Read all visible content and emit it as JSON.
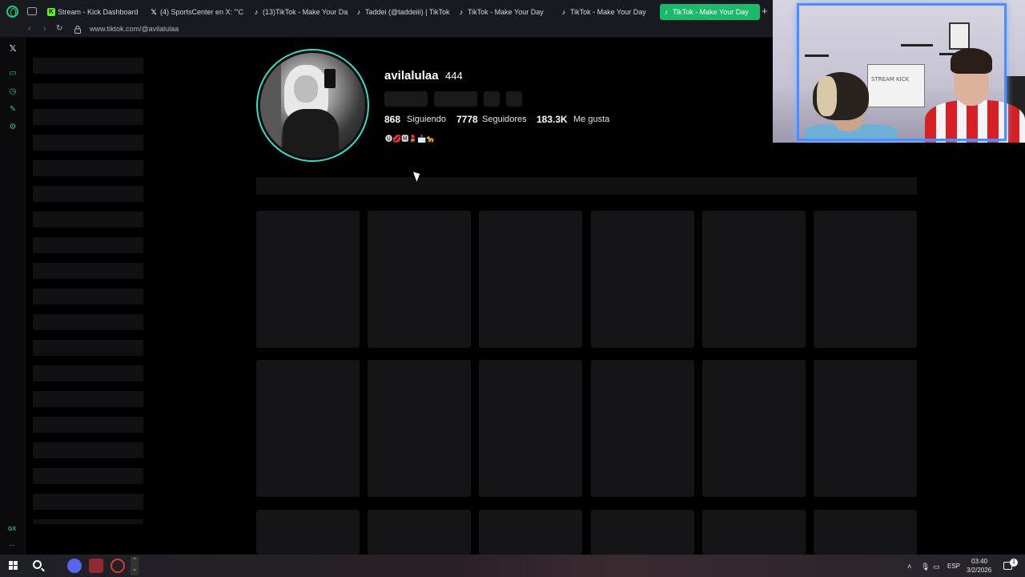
{
  "browser": {
    "tabs": [
      {
        "label": "Stream - Kick Dashboard",
        "favicon": "kick-icon",
        "fav_glyph": "K",
        "active": false
      },
      {
        "label": "(4) SportsCenter en X: \"'C",
        "favicon": "x-icon",
        "fav_glyph": "𝕏",
        "active": false
      },
      {
        "label": "(13)TikTok - Make Your Da",
        "favicon": "tiktok-icon",
        "fav_glyph": "♪",
        "active": false
      },
      {
        "label": "Taddei (@taddeiii) | TikTok",
        "favicon": "tiktok-icon",
        "fav_glyph": "♪",
        "active": false
      },
      {
        "label": "TikTok - Make Your Day",
        "favicon": "tiktok-icon",
        "fav_glyph": "♪",
        "active": false
      },
      {
        "label": "TikTok - Make Your Day",
        "favicon": "tiktok-icon",
        "fav_glyph": "♪",
        "active": false
      },
      {
        "label": "TikTok - Make Your Day",
        "favicon": "tiktok-icon",
        "fav_glyph": "♪",
        "active": true
      }
    ],
    "new_tab": "+",
    "url": "www.tiktok.com/@avilalulaa",
    "accent_color": "#1cb96b"
  },
  "sidebar": {
    "gx_label": "GX",
    "more": "..."
  },
  "profile": {
    "username": "avilalulaa",
    "name_suffix": "444",
    "stats": {
      "following_count": "868",
      "following_label": "Siguiendo",
      "followers_count": "7778",
      "followers_label": "Seguidores",
      "likes_count": "183.3K",
      "likes_label": "Me gusta"
    },
    "bio": "🅤💋🅼💄📩🐆",
    "avatar_ring_color": "#3fd7c6"
  },
  "webcam": {
    "board_text": "STREAM KICK"
  },
  "taskbar": {
    "language": "ESP",
    "time": "03:40",
    "date": "3/2/2026",
    "notification_count": "1"
  }
}
